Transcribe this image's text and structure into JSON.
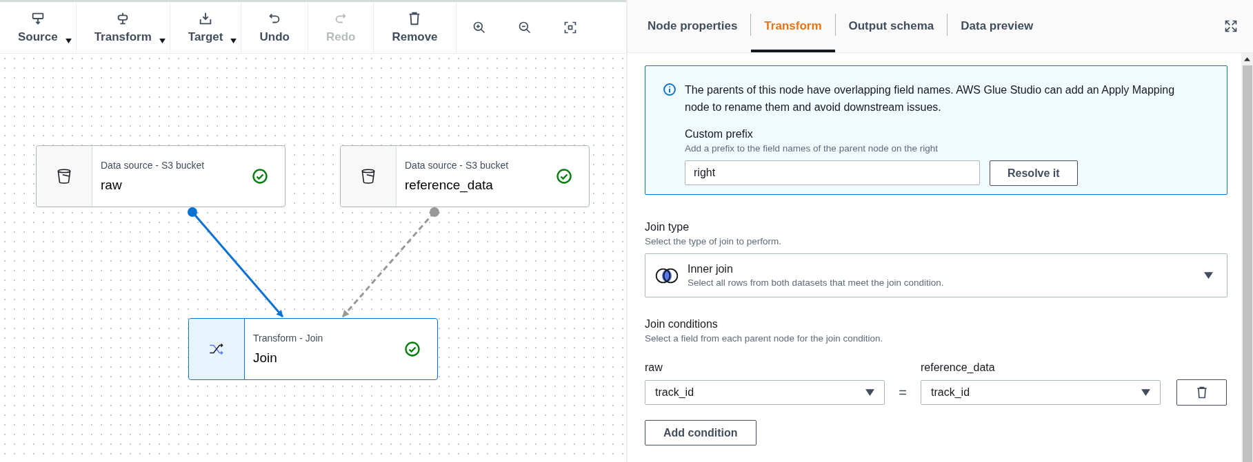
{
  "toolbar": [
    {
      "label": "Source",
      "dropdown": true,
      "disabled": false
    },
    {
      "label": "Transform",
      "dropdown": true,
      "disabled": false
    },
    {
      "label": "Target",
      "dropdown": true,
      "disabled": false
    },
    {
      "label": "Undo",
      "dropdown": false,
      "disabled": false
    },
    {
      "label": "Redo",
      "dropdown": false,
      "disabled": true
    },
    {
      "label": "Remove",
      "dropdown": false,
      "disabled": false
    }
  ],
  "canvas": {
    "nodes": [
      {
        "kind": "bucket",
        "type": "Data source - S3 bucket",
        "name": "raw",
        "selected": false
      },
      {
        "kind": "bucket",
        "type": "Data source - S3 bucket",
        "name": "reference_data",
        "selected": false
      },
      {
        "kind": "join",
        "type": "Transform - Join",
        "name": "Join",
        "selected": true
      }
    ],
    "edges": [
      {
        "selected": true
      },
      {
        "selected": false
      }
    ]
  },
  "tabs": [
    {
      "label": "Node properties",
      "selected": false
    },
    {
      "label": "Transform",
      "selected": true
    },
    {
      "label": "Output schema",
      "selected": false
    },
    {
      "label": "Data preview",
      "selected": false
    }
  ],
  "info": {
    "text": "The parents of this node have overlapping field names. AWS Glue Studio can add an Apply Mapping node to rename them and avoid downstream issues.",
    "prefix_label": "Custom prefix",
    "prefix_hint": "Add a prefix to the field names of the parent node on the right",
    "prefix_value": "right",
    "button": "Resolve it"
  },
  "join_type": {
    "label": "Join type",
    "hint": "Select the type of join to perform.",
    "option_title": "Inner join",
    "option_description": "Select all rows from both datasets that meet the join condition."
  },
  "join_conditions": {
    "label": "Join conditions",
    "hint": "Select a field from each parent node for the join condition.",
    "left_label": "raw",
    "right_label": "reference_data",
    "rows": [
      {
        "left": "track_id",
        "operator": "=",
        "right": "track_id"
      }
    ],
    "add_button": "Add condition"
  }
}
